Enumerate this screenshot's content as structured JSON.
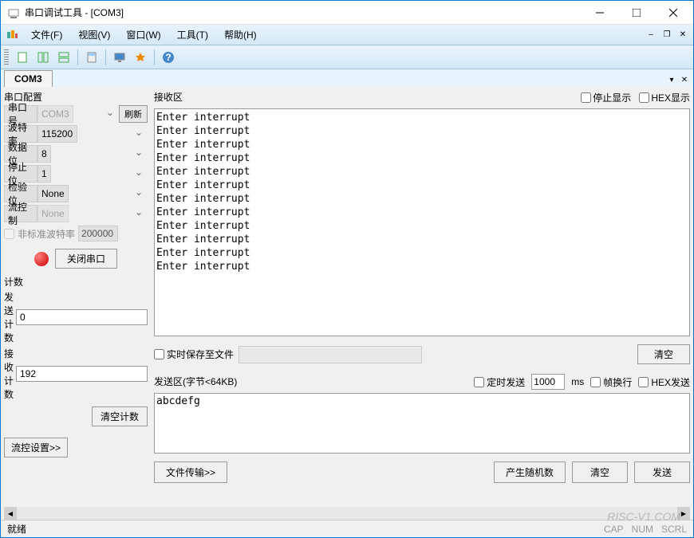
{
  "window": {
    "title": "串口调试工具 - [COM3]"
  },
  "menu": {
    "file": "文件(F)",
    "view": "视图(V)",
    "window": "窗口(W)",
    "tools": "工具(T)",
    "help": "帮助(H)"
  },
  "tab": {
    "label": "COM3"
  },
  "config": {
    "title": "串口配置",
    "port_label": "串口号",
    "port_value": "COM3",
    "refresh": "刷新",
    "baud_label": "波特率",
    "baud_value": "115200",
    "databits_label": "数据位",
    "databits_value": "8",
    "stopbits_label": "停止位",
    "stopbits_value": "1",
    "parity_label": "检验位",
    "parity_value": "None",
    "flowctrl_label": "流控制",
    "flowctrl_value": "None",
    "nonstd_label": "非标准波特率",
    "nonstd_value": "200000",
    "close_port": "关闭串口"
  },
  "count": {
    "title": "计数",
    "send_label": "发送计数",
    "send_value": "0",
    "recv_label": "接收计数",
    "recv_value": "192",
    "clear": "清空计数"
  },
  "flow_settings": "流控设置>>",
  "recv": {
    "title": "接收区",
    "stop_display": "停止显示",
    "hex_display": "HEX显示",
    "content": "Enter interrupt\nEnter interrupt\nEnter interrupt\nEnter interrupt\nEnter interrupt\nEnter interrupt\nEnter interrupt\nEnter interrupt\nEnter interrupt\nEnter interrupt\nEnter interrupt\nEnter interrupt",
    "save_to_file": "实时保存至文件",
    "clear": "清空"
  },
  "send": {
    "title": "发送区(字节<64KB)",
    "timer_send": "定时发送",
    "timer_value": "1000",
    "timer_unit": "ms",
    "wrap": "帧换行",
    "hex_send": "HEX发送",
    "content": "abcdefg",
    "file_transfer": "文件传输>>",
    "random": "产生随机数",
    "clear": "清空",
    "send_btn": "发送"
  },
  "status": {
    "ready": "就绪",
    "cap": "CAP",
    "num": "NUM",
    "scrl": "SCRL"
  },
  "watermark": "RISC-V1.COM"
}
